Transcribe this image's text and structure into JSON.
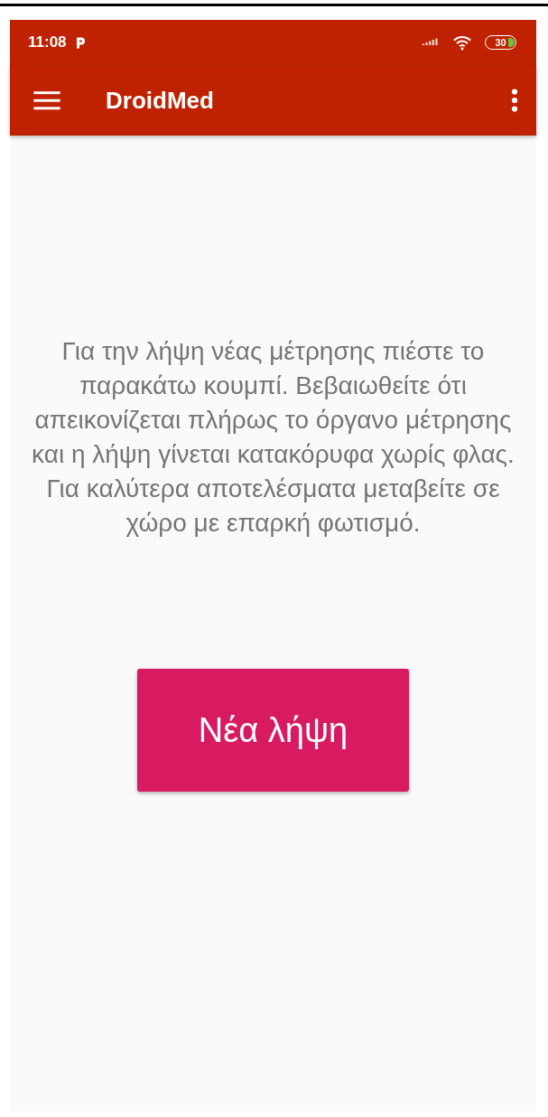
{
  "status_bar": {
    "time": "11:08",
    "battery": "30"
  },
  "toolbar": {
    "title": "DroidMed"
  },
  "instructions": "Για την λήψη νέας μέτρησης πιέστε το παρακάτω κουμπί. Βεβαιωθείτε ότι απεικονίζεται πλήρως το όργανο μέτρησης και η λήψη γίνεται κατακόρυφα χωρίς φλας. Για καλύτερα αποτελέσματα μεταβείτε σε χώρο με επαρκή φωτισμό.",
  "action_button": {
    "label": "Νέα λήψη"
  }
}
